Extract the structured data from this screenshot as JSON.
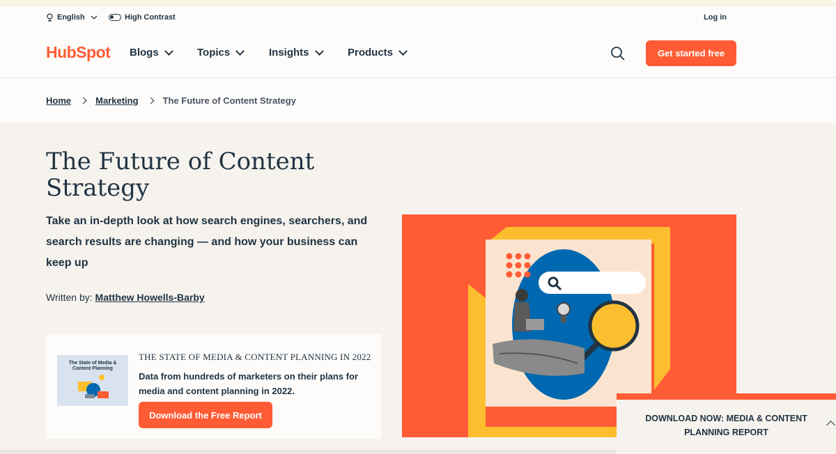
{
  "utility": {
    "language": "English",
    "contrast": "High Contrast",
    "login": "Log in"
  },
  "nav": {
    "logo": "HubSpot",
    "items": [
      {
        "label": "Blogs"
      },
      {
        "label": "Topics"
      },
      {
        "label": "Insights"
      },
      {
        "label": "Products"
      }
    ],
    "cta": "Get started free"
  },
  "breadcrumb": {
    "home": "Home",
    "section": "Marketing",
    "current": "The Future of Content Strategy"
  },
  "article": {
    "title": "The Future of Content Strategy",
    "subtitle": "Take an in-depth look at how search engines, searchers, and search results are changing — and how your business can keep up",
    "byline_prefix": "Written by:",
    "author": "Matthew Howells-Barby"
  },
  "promo": {
    "thumb_title": "The State of Media & Content Planning",
    "heading": "THE STATE OF MEDIA & CONTENT PLANNING IN 2022",
    "text": "Data from hundreds of marketers on their plans for media and content planning in 2022.",
    "button": "Download the Free Report"
  },
  "sticky": {
    "text": "DOWNLOAD NOW: MEDIA & CONTENT PLANNING REPORT"
  },
  "colors": {
    "accent": "#ff5c35",
    "text": "#213343",
    "yellow": "#fcbe2e",
    "blue": "#0068b1",
    "background": "#f6f3ee"
  }
}
